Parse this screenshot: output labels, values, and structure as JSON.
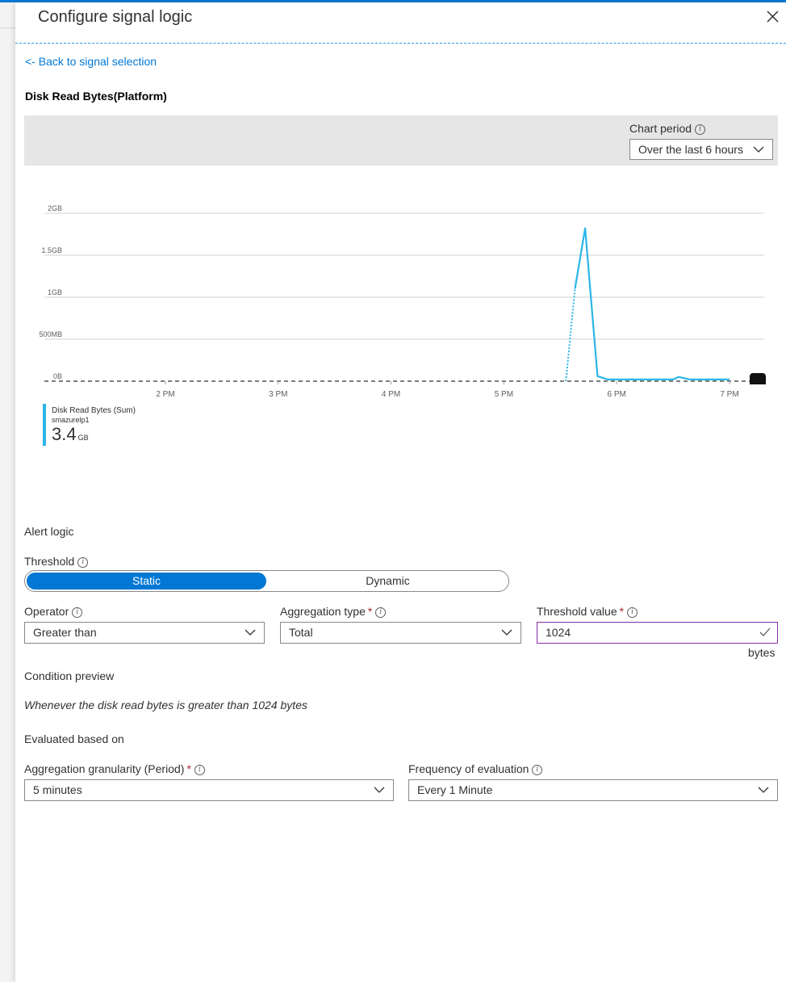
{
  "header": {
    "title": "Configure signal logic"
  },
  "back_link": "<- Back to signal selection",
  "signal_name": "Disk Read Bytes(Platform)",
  "chart_period": {
    "label": "Chart period",
    "value": "Over the last 6 hours"
  },
  "chart_data": {
    "type": "line",
    "title": "",
    "y_ticks": [
      "2GB",
      "1.5GB",
      "1GB",
      "500MB",
      "0B"
    ],
    "x_ticks": [
      "2 PM",
      "3 PM",
      "4 PM",
      "5 PM",
      "6 PM",
      "7 PM"
    ],
    "ylim_gb": [
      0,
      2
    ],
    "series": [
      {
        "name": "Disk Read Bytes (Sum)",
        "color": "#2cb5e9",
        "points_hours": [
          [
            17.55,
            0.0
          ],
          [
            17.63,
            1.1
          ],
          [
            17.72,
            1.82
          ],
          [
            17.83,
            0.06
          ],
          [
            17.92,
            0.02
          ],
          [
            18.1,
            0.02
          ],
          [
            18.3,
            0.02
          ],
          [
            18.5,
            0.02
          ],
          [
            18.55,
            0.05
          ],
          [
            18.65,
            0.02
          ],
          [
            18.8,
            0.02
          ],
          [
            19.0,
            0.02
          ]
        ]
      }
    ],
    "threshold_line": 0.0,
    "grid": true
  },
  "legend": {
    "metric": "Disk Read Bytes (Sum)",
    "resource": "smazurelp1",
    "value": "3.4",
    "unit": "GB"
  },
  "alert_logic": {
    "heading": "Alert logic",
    "threshold_label": "Threshold",
    "threshold_options": [
      "Static",
      "Dynamic"
    ],
    "operator": {
      "label": "Operator",
      "value": "Greater than"
    },
    "aggregation_type": {
      "label": "Aggregation type",
      "value": "Total"
    },
    "threshold_value": {
      "label": "Threshold value",
      "value": "1024",
      "unit": "bytes"
    }
  },
  "condition_preview": {
    "heading": "Condition preview",
    "text": "Whenever the disk read bytes is greater than 1024 bytes"
  },
  "evaluated": {
    "heading": "Evaluated based on",
    "granularity": {
      "label": "Aggregation granularity (Period)",
      "value": "5 minutes"
    },
    "frequency": {
      "label": "Frequency of evaluation",
      "value": "Every 1 Minute"
    }
  }
}
